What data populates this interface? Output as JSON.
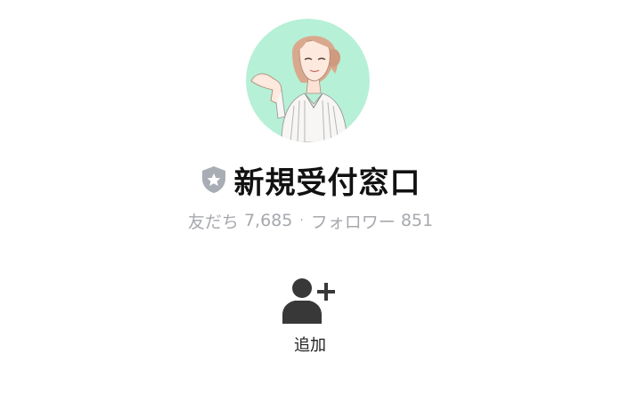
{
  "profile": {
    "name": "新規受付窓口",
    "badge_icon": "shield-star-icon",
    "avatar_bg": "#b6f0d7"
  },
  "stats": {
    "friends_label": "友だち",
    "friends_count": "7,685",
    "separator": "·",
    "followers_label": "フォロワー",
    "followers_count": "851"
  },
  "actions": {
    "add_label": "追加",
    "add_icon": "add-friend-icon"
  }
}
